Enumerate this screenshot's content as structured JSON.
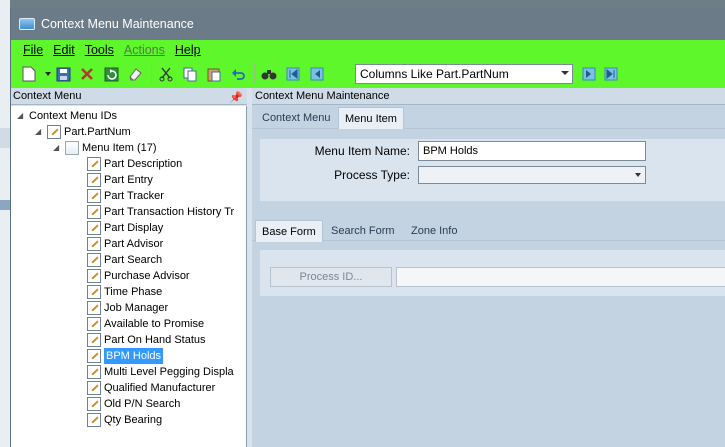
{
  "window": {
    "title": "Context Menu Maintenance"
  },
  "menu": [
    {
      "label": "File",
      "disabled": false
    },
    {
      "label": "Edit",
      "disabled": false
    },
    {
      "label": "Tools",
      "disabled": false
    },
    {
      "label": "Actions",
      "disabled": true
    },
    {
      "label": "Help",
      "disabled": false
    }
  ],
  "toolbar": {
    "combo_value": "Columns Like Part.PartNum",
    "icons": [
      "new-icon",
      "dropdown-arrow-icon",
      "save-icon",
      "delete-icon",
      "refresh-icon",
      "clear-icon",
      "cut-icon",
      "copy-icon",
      "paste-icon",
      "undo-icon",
      "binoculars-icon",
      "first-record-icon",
      "previous-record-icon",
      "next-record-icon",
      "last-record-icon"
    ]
  },
  "left_panel": {
    "header": "Context Menu"
  },
  "tree": {
    "root": "Context Menu IDs",
    "context": "Part.PartNum",
    "menu_item_group": "Menu Item (17)",
    "selected": "BPM Holds",
    "items": [
      "Part Description",
      "Part Entry",
      "Part Tracker",
      "Part Transaction History Tr",
      "Part Display",
      "Part Advisor",
      "Part Search",
      "Purchase Advisor",
      "Time Phase",
      "Job Manager",
      "Available to Promise",
      "Part On Hand Status",
      "BPM Holds",
      "Multi Level Pegging Displa",
      "Qualified Manufacturer",
      "Old P/N Search",
      "Qty Bearing"
    ]
  },
  "right_panel": {
    "header": "Context Menu Maintenance",
    "tabs": [
      "Context Menu",
      "Menu Item"
    ],
    "active_tab": "Menu Item",
    "menu_item_name_label": "Menu Item Name:",
    "menu_item_name_value": "BPM Holds",
    "process_type_label": "Process Type:",
    "process_type_value": "",
    "sub_tabs": [
      "Base Form",
      "Search Form",
      "Zone Info"
    ],
    "active_sub_tab": "Base Form",
    "process_id_button": "Process ID...",
    "process_id_value": ""
  }
}
